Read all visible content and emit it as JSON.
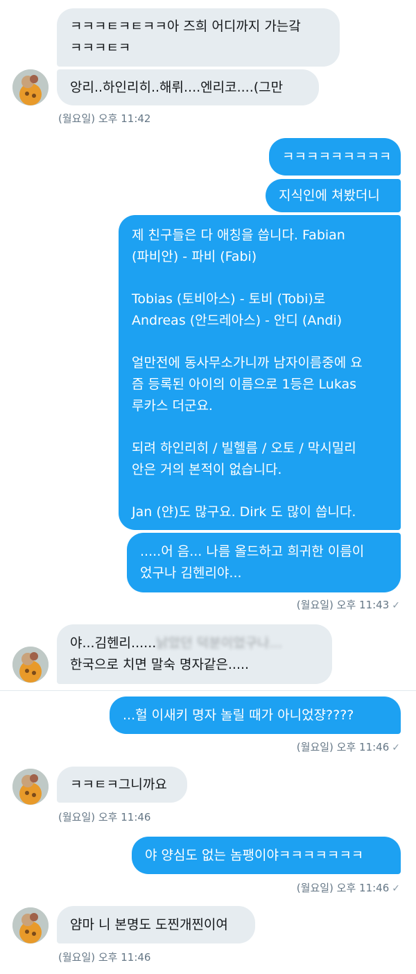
{
  "messages": {
    "m1": {
      "line1": "ㅋㅋㅋㅌㅋㅌㅋㅋ아 즈희 어디까지 가는갘",
      "line2": "ㅋㅋㅋㅌㅋ"
    },
    "m2": {
      "text": "앙리..하인리히..해뤼....엔리코....(그만"
    },
    "ts1": "(월요일) 오후 11:42",
    "m3": {
      "text": "ㅋㅋㅋㅋㅋㅋㅋㅋㅋ"
    },
    "m4": {
      "text": "지식인에 쳐봤더니"
    },
    "m5": {
      "p1l1": "제 친구들은 다 애칭을 씁니다. Fabian",
      "p1l2": "(파비안) - 파비 (Fabi)",
      "p2l1": "Tobias (토비아스) - 토비 (Tobi)로",
      "p2l2": "Andreas (안드레아스) - 안디 (Andi)",
      "p3l1": "얼만전에 동사무소가니까 남자이름중에 요",
      "p3l2": "즘 등록된 아이의 이름으로 1등은 Lukas",
      "p3l3": "루카스 더군요.",
      "p4l1": "되려 하인리히 / 빌헬름 / 오토 / 막시밀리",
      "p4l2": "안은 거의 본적이 없습니다.",
      "p5l1": "Jan (얀)도 많구요. Dirk 도 많이 씁니다."
    },
    "m6": {
      "line1": ".....어 음... 나름 올드하고 희귀한 이름이",
      "line2": "었구나 김헨리야..."
    },
    "ts2": "(월요일) 오후 11:43",
    "m7": {
      "line1_visible": "야...김헨리......",
      "line1_blurred": "낡았던 덕분이었구나...",
      "line2": "한국으로 치면 말숙 명자같은....."
    },
    "m8": {
      "text": "...헐 이새키 명자 놀릴 때가 아니었쟝????"
    },
    "ts3": "(월요일) 오후 11:46",
    "m9": {
      "text": "ㅋㅋㅌㅋ그니까요"
    },
    "ts4": "(월요일) 오후 11:46",
    "m10": {
      "text": "야 양심도 없는 놈팽이야ㅋㅋㅋㅋㅋㅋㅋ"
    },
    "ts5": "(월요일) 오후 11:46",
    "m11": {
      "text": "얌마 니 본명도 도찐개찐이여"
    },
    "ts6": "(월요일) 오후 11:46"
  },
  "icons": {
    "read_check": "✓",
    "avatar": "user-avatar"
  },
  "colors": {
    "outgoing": "#1da1f2",
    "incoming": "#e6ecf0",
    "meta": "#657786"
  }
}
